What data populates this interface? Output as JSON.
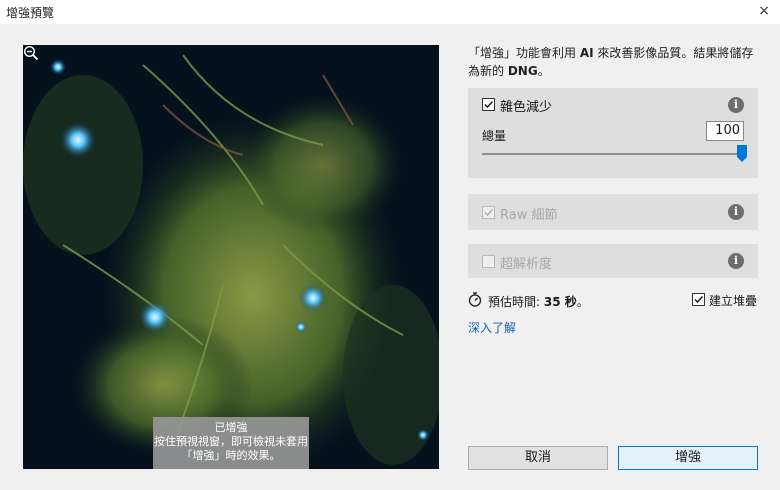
{
  "window": {
    "title": "增強預覽",
    "close_glyph": "×"
  },
  "preview": {
    "caption_title": "已增強",
    "caption_line1": "按住預視視窗，即可檢視未套用",
    "caption_line2": "「增強」時的效果。",
    "zoom_icon": "zoom-out-icon"
  },
  "description": {
    "part1": "「增強」功能會利用 ",
    "ai": "AI",
    "part2": " 來改善影像品質。結果將儲存為新的 ",
    "dng": "DNG",
    "part3": "。"
  },
  "denoise": {
    "label": "雜色減少",
    "checked": true,
    "amount_label": "總量",
    "amount_value": "100",
    "slider_fraction": 1.0,
    "info_glyph": "i"
  },
  "raw_details": {
    "label": "Raw 細節",
    "checked": true,
    "disabled": true,
    "info_glyph": "i"
  },
  "super_resolution": {
    "label": "超解析度",
    "checked": false,
    "disabled": true,
    "info_glyph": "i"
  },
  "estimate": {
    "label": "預估時間: ",
    "value": "35 秒",
    "suffix": "。",
    "icon": "stopwatch-icon"
  },
  "create_stack": {
    "label": "建立堆疊",
    "checked": true
  },
  "learn_more": "深入了解",
  "buttons": {
    "cancel": "取消",
    "enhance": "增強"
  },
  "colors": {
    "accent": "#0078d7",
    "link": "#1a5fb4",
    "panel": "#dedede"
  }
}
